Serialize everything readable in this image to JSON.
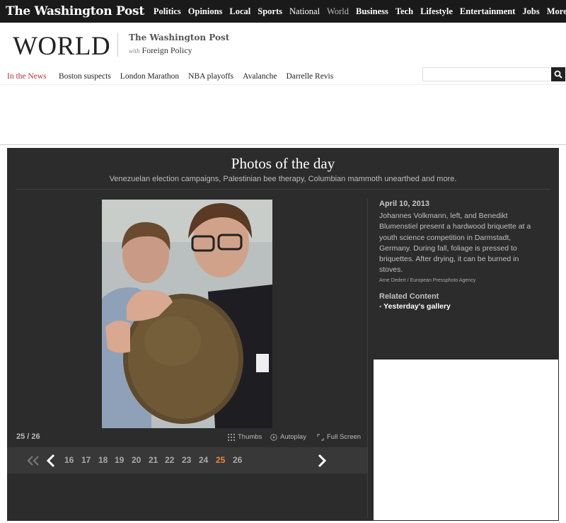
{
  "topnav": {
    "logo": "The Washington Post",
    "items": [
      "Politics",
      "Opinions",
      "Local",
      "Sports",
      "National",
      "World",
      "Business",
      "Tech",
      "Lifestyle",
      "Entertainment",
      "Jobs",
      "More"
    ]
  },
  "section": {
    "title": "WORLD",
    "partner_top": "The Washington Post",
    "partner_with": "with",
    "partner_name": "Foreign Policy"
  },
  "news": {
    "label": "In the News",
    "items": [
      "Boston suspects",
      "London Marathon",
      "NBA playoffs",
      "Avalanche",
      "Darrelle Revis"
    ]
  },
  "gallery": {
    "title": "Photos of the day",
    "subtitle": "Venezuelan election campaigns, Palestinian bee therapy, Columbian mammoth unearthed and more.",
    "counter": "25 / 26",
    "controls": {
      "thumbs": "Thumbs",
      "autoplay": "Autoplay",
      "fullscreen": "Full Screen"
    },
    "pages": [
      "16",
      "17",
      "18",
      "19",
      "20",
      "21",
      "22",
      "23",
      "24",
      "25",
      "26"
    ],
    "active_page": "25"
  },
  "caption": {
    "date": "April 10, 2013",
    "text": "Johannes Volkmann, left, and Benedikt Blumenstiel present a hardwood briquette at a youth science competition in Darmstadt, Germany. During fall, foliage is pressed to briquettes. After drying, it can be burned in stoves.",
    "credit": "Arne Dedert / European Pressphoto Agency",
    "related_header": "Related Content",
    "related_link": "Yesterday's gallery"
  },
  "colors": {
    "accent_red": "#b0353a",
    "active_page": "#e8883a",
    "gallery_bg": "#2c2c2c"
  }
}
